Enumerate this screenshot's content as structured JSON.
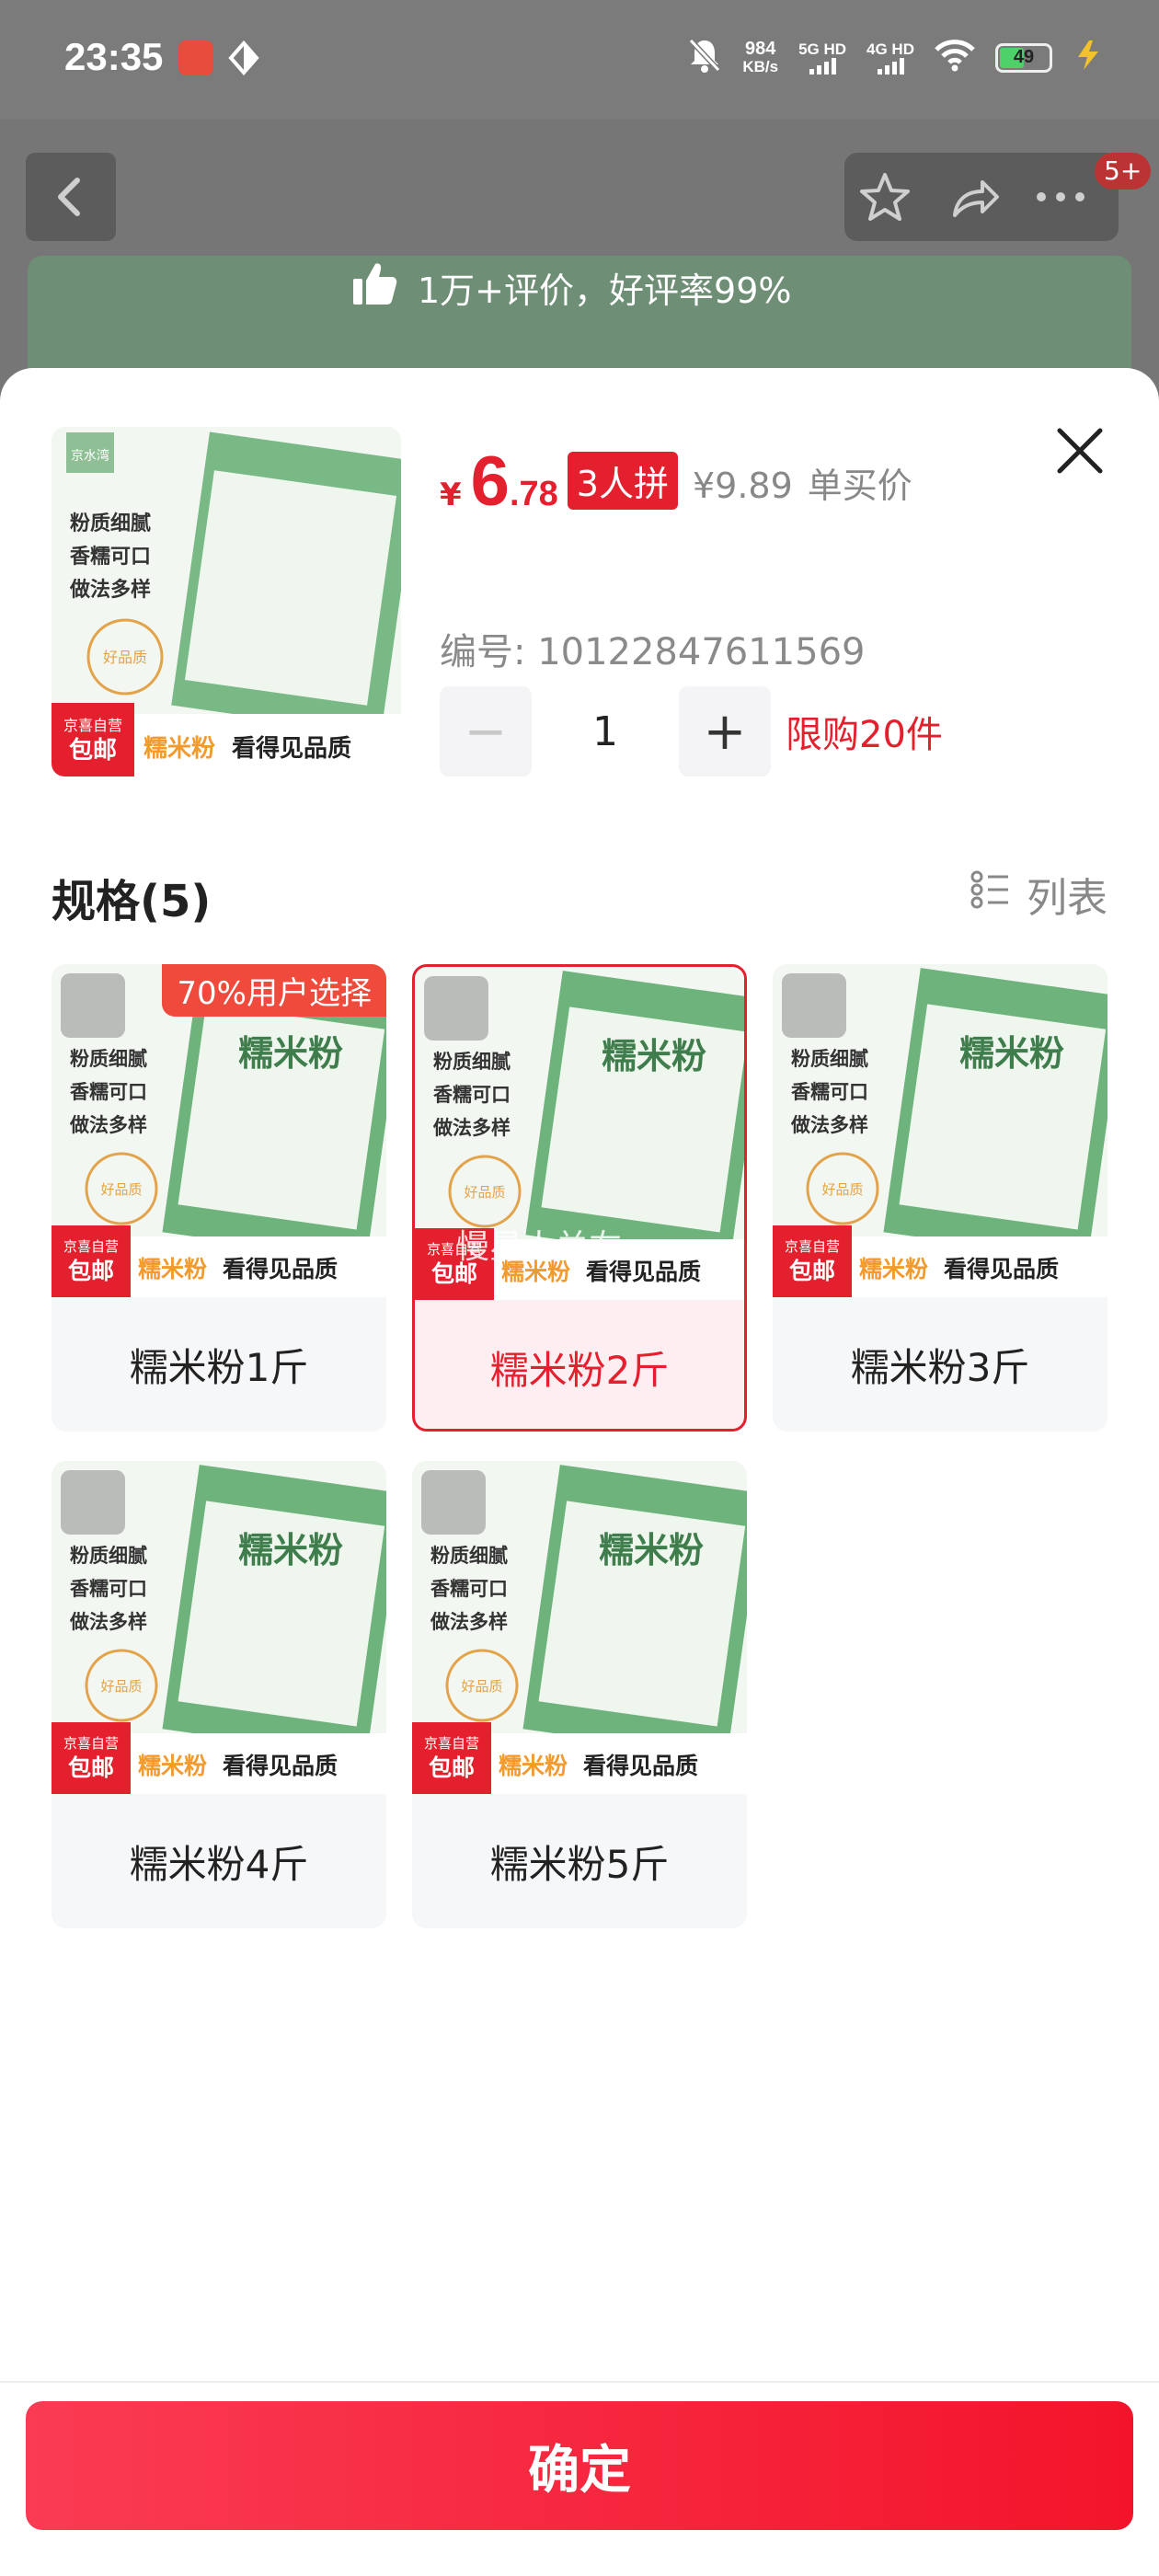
{
  "status_bar": {
    "time": "23:35",
    "speed_value": "984",
    "speed_unit": "KB/s",
    "net1": "5G HD",
    "net2": "4G HD",
    "battery": "49"
  },
  "background": {
    "notification_badge": "5+",
    "review_tip": "1万+评价，好评率99%"
  },
  "product": {
    "currency": "¥",
    "price_int": "6",
    "price_dec": ".78",
    "group_label": "3人拼",
    "single_price": "¥9.89",
    "single_label": "单买价",
    "sku_label": "编号: 10122847611569",
    "quantity": "1",
    "limit_text": "限购20件",
    "minus_label": "−",
    "plus_label": "+"
  },
  "spec": {
    "title": "规格(5)",
    "list_toggle_label": "列表",
    "popular_tag": "70%用户选择",
    "options": [
      {
        "label": "糯米粉1斤",
        "selected": false
      },
      {
        "label": "糯米粉2斤",
        "selected": true
      },
      {
        "label": "糯米粉3斤",
        "selected": false
      },
      {
        "label": "糯米粉4斤",
        "selected": false
      },
      {
        "label": "糯米粉5斤",
        "selected": false
      }
    ]
  },
  "package_art": {
    "brand": "京水湾",
    "product_name": "糯米粉",
    "lines": [
      "粉质细腻",
      "香糯可口",
      "做法多样"
    ],
    "tag_store": "京喜自营",
    "tag_ship": "包邮",
    "slogan": "看得见品质"
  },
  "watermark": "慢星人关右",
  "confirm_label": "确定",
  "colors": {
    "accent": "#e4202e",
    "confirm_start": "#fa3b53",
    "confirm_end": "#f3142b",
    "package_green": "#6fb37c"
  }
}
